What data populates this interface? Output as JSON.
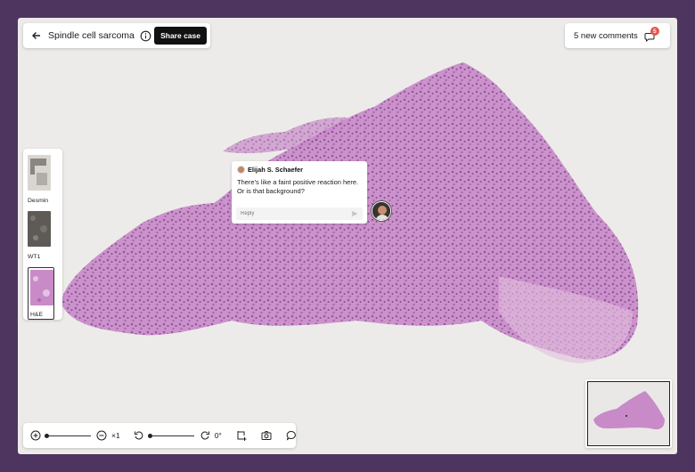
{
  "header": {
    "back_icon": "arrow-left-icon",
    "case_title": "Spindle cell sarcoma",
    "info_icon": "info-circle-icon",
    "share_label": "Share case"
  },
  "comments_button": {
    "label": "5 new comments",
    "icon": "chat-bubble-icon",
    "badge_count": "5",
    "badge_color": "#e3574b"
  },
  "stains": [
    {
      "label": "Desmin",
      "active": false
    },
    {
      "label": "WT1",
      "active": false
    },
    {
      "label": "H&E",
      "active": true
    }
  ],
  "comment": {
    "author": "Elijah S. Schaefer",
    "text": "There's like a faint positive reaction here. Or is that background?",
    "reply_placeholder": "Reply",
    "send_icon": "send-icon"
  },
  "toolbar": {
    "zoom_in_icon": "zoom-in-icon",
    "zoom_out_icon": "zoom-out-icon",
    "zoom_level": "×1",
    "rotate_icon": "rotate-ccw-icon",
    "rotate_cw_icon": "rotate-cw-icon",
    "rotation": "0°",
    "crop_icon": "crop-add-icon",
    "camera_icon": "camera-icon",
    "comment_icon": "comment-icon"
  },
  "colors": {
    "frame": "#4e3560",
    "tissue": "#c98ac8",
    "accent": "#111111"
  }
}
